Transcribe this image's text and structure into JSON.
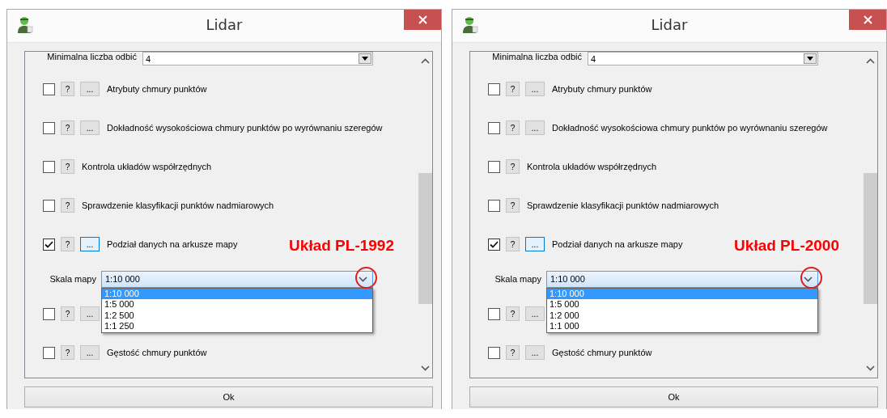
{
  "windows": [
    {
      "title": "Lidar",
      "ok": "Ok",
      "rows": [
        {
          "kind": "combo",
          "label": "Minimalna liczba odbić",
          "value": "4"
        },
        {
          "kind": "option",
          "label": "Atrybuty chmury punktów",
          "checked": false,
          "help": "?",
          "more": "..."
        },
        {
          "kind": "option",
          "label": "Dokładność wysokościowa chmury punktów po wyrównaniu szeregów",
          "checked": false,
          "help": "?",
          "more": "..."
        },
        {
          "kind": "option",
          "label": "Kontrola układów współrzędnych",
          "checked": false,
          "help": "?"
        },
        {
          "kind": "option",
          "label": "Sprawdzenie klasyfikacji punktów nadmiarowych",
          "checked": false,
          "help": "?"
        },
        {
          "kind": "option",
          "label": "Podział danych na arkusze mapy",
          "checked": true,
          "help": "?",
          "more": "..."
        },
        {
          "kind": "scale",
          "label": "Skala mapy",
          "value": "1:10 000",
          "annotation": "Układ PL-1992",
          "options": [
            {
              "label": "1:10 000",
              "selected": true
            },
            {
              "label": "1:5 000",
              "selected": false
            },
            {
              "label": "1:2 500",
              "selected": false
            },
            {
              "label": "1:1 250",
              "selected": false
            }
          ]
        },
        {
          "kind": "option",
          "checked": false,
          "help": "?",
          "more": "..."
        },
        {
          "kind": "option",
          "label": "Gęstość chmury punktów",
          "checked": false,
          "help": "?",
          "more": "..."
        }
      ]
    },
    {
      "title": "Lidar",
      "ok": "Ok",
      "rows": [
        {
          "kind": "combo",
          "label": "Minimalna liczba odbić",
          "value": "4"
        },
        {
          "kind": "option",
          "label": "Atrybuty chmury punktów",
          "checked": false,
          "help": "?",
          "more": "..."
        },
        {
          "kind": "option",
          "label": "Dokładność wysokościowa chmury punktów po wyrównaniu szeregów",
          "checked": false,
          "help": "?",
          "more": "..."
        },
        {
          "kind": "option",
          "label": "Kontrola układów współrzędnych",
          "checked": false,
          "help": "?"
        },
        {
          "kind": "option",
          "label": "Sprawdzenie klasyfikacji punktów nadmiarowych",
          "checked": false,
          "help": "?"
        },
        {
          "kind": "option",
          "label": "Podział danych na arkusze mapy",
          "checked": true,
          "help": "?",
          "more": "..."
        },
        {
          "kind": "scale",
          "label": "Skala mapy",
          "value": "1:10 000",
          "annotation": "Układ PL-2000",
          "options": [
            {
              "label": "1:10 000",
              "selected": true
            },
            {
              "label": "1:5 000",
              "selected": false
            },
            {
              "label": "1:2 000",
              "selected": false
            },
            {
              "label": "1:1 000",
              "selected": false
            }
          ]
        },
        {
          "kind": "option",
          "checked": false,
          "help": "?",
          "more": "..."
        },
        {
          "kind": "option",
          "label": "Gęstość chmury punktów",
          "checked": false,
          "help": "?",
          "more": "..."
        }
      ]
    }
  ]
}
